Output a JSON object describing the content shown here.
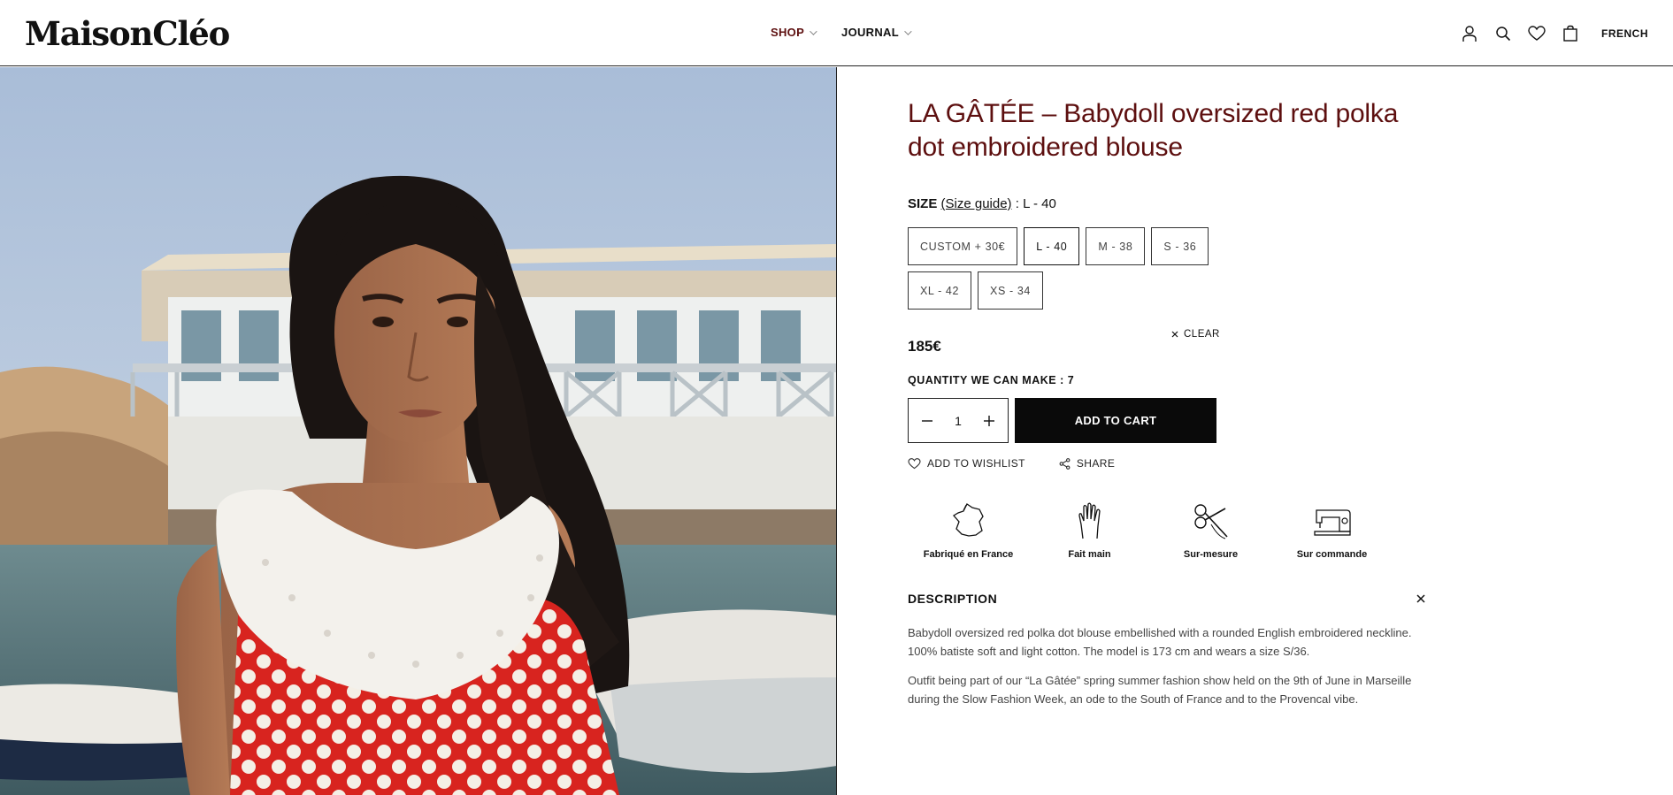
{
  "header": {
    "logo": "MaisonCléo",
    "nav": [
      {
        "label": "SHOP"
      },
      {
        "label": "JOURNAL"
      }
    ],
    "icons": [
      "account-icon",
      "search-icon",
      "heart-icon",
      "bag-icon"
    ],
    "language": "FRENCH"
  },
  "colors": {
    "accent": "#5d0f0f",
    "black": "#0a0a0a",
    "polka_red": "#d8241f"
  },
  "product": {
    "title": "LA GÂTÉE – Babydoll oversized red polka dot embroidered blouse",
    "size_label": "SIZE",
    "size_guide": "(Size guide)",
    "size_selected_text": ": L - 40",
    "sizes": [
      {
        "label": "CUSTOM + 30€"
      },
      {
        "label": "L - 40"
      },
      {
        "label": "M - 38"
      },
      {
        "label": "S - 36"
      },
      {
        "label": "XL - 42"
      },
      {
        "label": "XS - 34"
      }
    ],
    "clear_label": "CLEAR",
    "price": "185€",
    "quantity_label": "QUANTITY WE CAN MAKE : 7",
    "quantity": "1",
    "add_to_cart": "ADD TO CART",
    "wishlist": "ADD TO WISHLIST",
    "share": "SHARE",
    "badges": [
      {
        "label": "Fabriqué en France",
        "icon": "france-map-icon"
      },
      {
        "label": "Fait main",
        "icon": "hand-icon"
      },
      {
        "label": "Sur-mesure",
        "icon": "scissors-icon"
      },
      {
        "label": "Sur commande",
        "icon": "sewing-machine-icon"
      }
    ],
    "description_title": "DESCRIPTION",
    "description": [
      "Babydoll oversized red polka dot blouse embellished with a rounded English embroidered neckline. 100% batiste soft and light cotton. The model is 173 cm and wears a size S/36.",
      "Outfit being part of our “La Gâtée” spring summer fashion show held on the 9th of June in Marseille during the Slow Fashion Week, an ode to the South of France and to the Provencal vibe."
    ]
  }
}
